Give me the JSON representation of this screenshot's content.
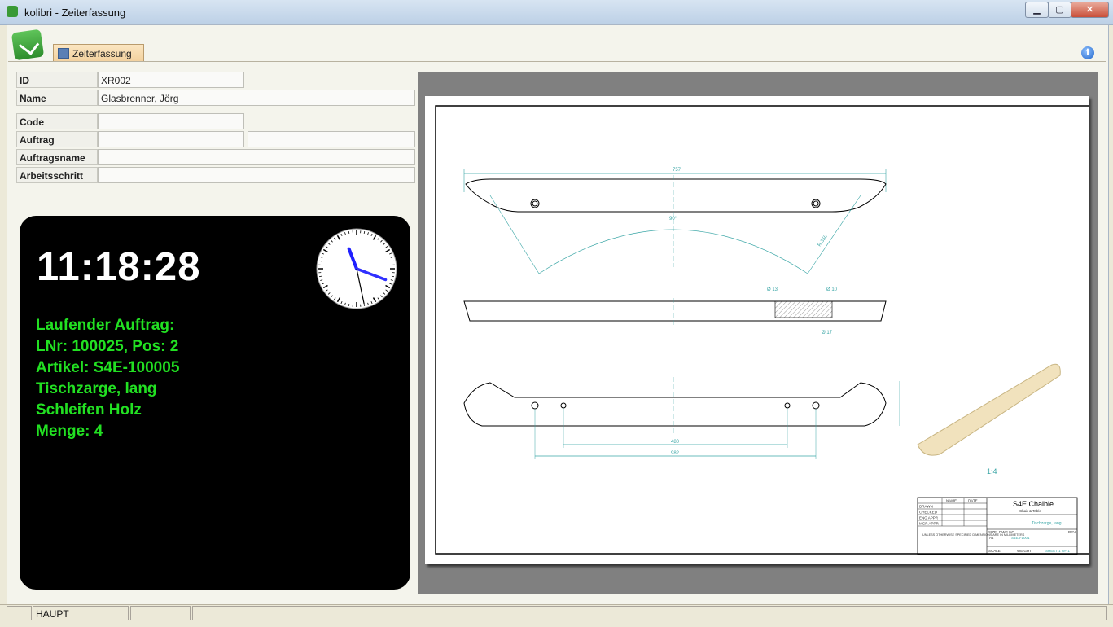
{
  "window": {
    "title": "kolibri - Zeiterfassung",
    "minimize": "▁",
    "maximize": "▢",
    "close": "✕"
  },
  "tab": {
    "label": "Zeiterfassung"
  },
  "form": {
    "id_label": "ID",
    "id_value": "XR002",
    "name_label": "Name",
    "name_value": "Glasbrenner, Jörg",
    "code_label": "Code",
    "code_value": "",
    "auftrag_label": "Auftrag",
    "auftrag_value": "",
    "auftrag_value2": "",
    "auftragsname_label": "Auftragsname",
    "auftragsname_value": "",
    "arbeitsschritt_label": "Arbeitsschritt",
    "arbeitsschritt_value": ""
  },
  "clock": {
    "time": "11:18:28",
    "hours": 11,
    "minutes": 18,
    "seconds": 28
  },
  "job": {
    "heading": "Laufender Auftrag:",
    "line1": "LNr: 100025, Pos: 2",
    "line2": "Artikel: S4E-100005",
    "line3": "Tischzarge, lang",
    "line4": "Schleifen Holz",
    "line5": "Menge: 4"
  },
  "drawing": {
    "dim_top": "757",
    "dim_angle": "90°",
    "dim_radius": "R 350",
    "dim_phi1": "Ø 13",
    "dim_phi2": "Ø 10",
    "dim_phi3": "Ø 17",
    "dim_480": "480",
    "dim_982": "982",
    "scale_note": "1:4",
    "titleblock": {
      "company": "S4E Chaible",
      "company_sub": "Chair & Table",
      "part": "Tischzarge, lang",
      "number": "S4E3-1001",
      "name_hdr": "NAME",
      "date_hdr": "DATE",
      "drawn": "DRAWN",
      "checked": "CHECKED",
      "eng_appr": "ENG APPR",
      "mgr_appr": "MGR APPR",
      "notes": "UNLESS OTHERWISE SPECIFIED DIMENSIONS ARE IN MILLIMETERS",
      "size": "SIZE",
      "dwg": "DWG NO",
      "rev": "REV",
      "a4": "A4",
      "scale": "SCALE",
      "weight": "WEIGHT",
      "sheet": "SHEET 1 OF 1"
    }
  },
  "status": {
    "cell1": "",
    "cell2": "HAUPT",
    "cell3": "",
    "cell4": ""
  },
  "colors": {
    "job_text": "#22e022",
    "clock_bg": "#000000",
    "tab_bg": "#f2d09d"
  }
}
